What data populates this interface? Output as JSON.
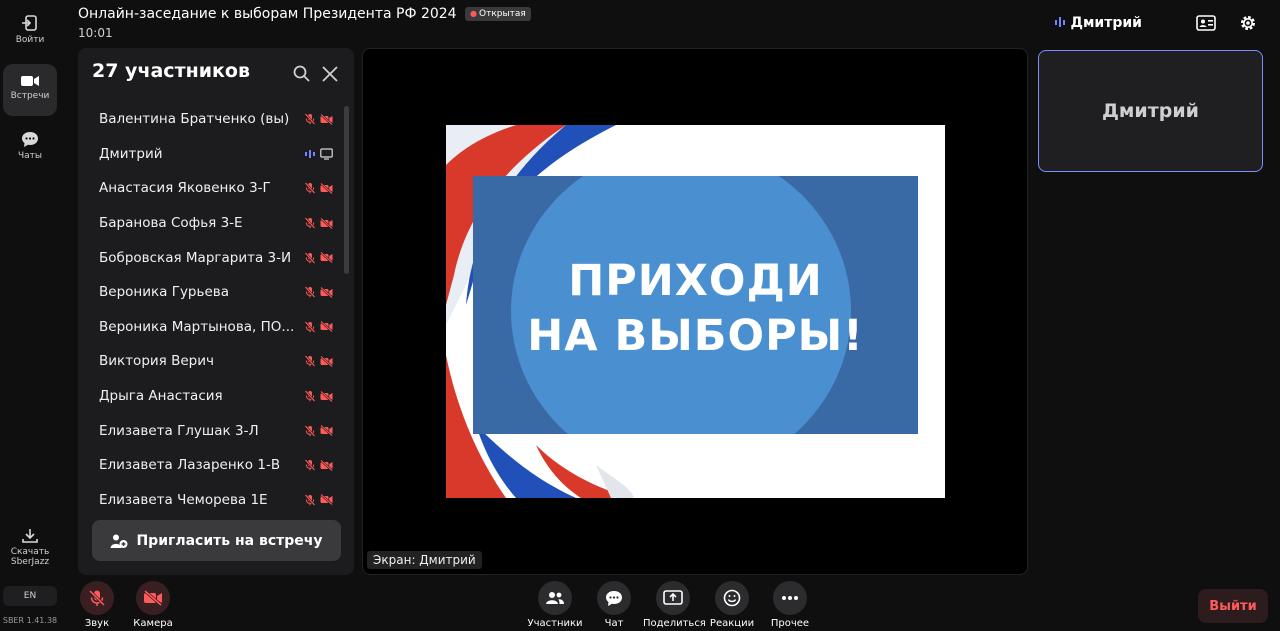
{
  "app": {
    "version": "SBER 1.41.38",
    "lang": "EN"
  },
  "rail": {
    "login_label": "Войти",
    "meetings_label": "Встречи",
    "chats_label": "Чаты",
    "download_label_1": "Скачать",
    "download_label_2": "SberJazz"
  },
  "header": {
    "title": "Онлайн-заседание к выборам Президента РФ 2024",
    "badge": "Открытая",
    "time": "10:01",
    "active_speaker": "Дмитрий"
  },
  "participants": {
    "title": "27 участников",
    "items": [
      {
        "name": "Валентина Братченко (вы)",
        "mic": "off",
        "cam": "off"
      },
      {
        "name": "Дмитрий",
        "mic": "speaking",
        "cam": "screen"
      },
      {
        "name": "Анастасия Яковенко 3-Г",
        "mic": "off",
        "cam": "off"
      },
      {
        "name": "Баранова Софья 3-Е",
        "mic": "off",
        "cam": "off"
      },
      {
        "name": "Бобровская Маргарита 3-И",
        "mic": "off",
        "cam": "off"
      },
      {
        "name": "Вероника Гурьева",
        "mic": "off",
        "cam": "off"
      },
      {
        "name": "Вероника Мартынова, ПО...",
        "mic": "off",
        "cam": "off"
      },
      {
        "name": "Виктория Верич",
        "mic": "off",
        "cam": "off"
      },
      {
        "name": "Дрыга Анастасия",
        "mic": "off",
        "cam": "off"
      },
      {
        "name": "Елизавета Глушак 3-Л",
        "mic": "off",
        "cam": "off"
      },
      {
        "name": "Елизавета Лазаренко 1-В",
        "mic": "off",
        "cam": "off"
      },
      {
        "name": "Елизавета Чеморева 1Е",
        "mic": "off",
        "cam": "off"
      }
    ],
    "invite_label": "Пригласить на встречу"
  },
  "stage": {
    "slide_line1": "ПРИХОДИ",
    "slide_line2": "НА ВЫБОРЫ!",
    "screen_label": "Экран: Дмитрий"
  },
  "tile": {
    "name": "Дмитрий"
  },
  "toolbar": {
    "sound_label": "Звук",
    "camera_label": "Камера",
    "participants_label": "Участники",
    "chat_label": "Чат",
    "share_label": "Поделиться",
    "reactions_label": "Реакции",
    "more_label": "Прочее",
    "leave_label": "Выйти"
  },
  "colors": {
    "accent": "#7b8cff",
    "danger": "#ff5b5b",
    "slide_blue": "#3a6aa6"
  }
}
